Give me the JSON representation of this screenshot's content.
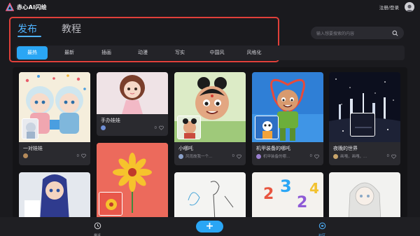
{
  "app": {
    "name": "赤心AI闪绘"
  },
  "topbar": {
    "login_label": "注册/登录"
  },
  "header": {
    "tabs": [
      {
        "label": "发布",
        "active": true
      },
      {
        "label": "教程",
        "active": false
      }
    ]
  },
  "search": {
    "placeholder": "输入想要搜索的内容"
  },
  "categories": [
    {
      "label": "最热",
      "active": true
    },
    {
      "label": "最新"
    },
    {
      "label": "插画"
    },
    {
      "label": "动漫"
    },
    {
      "label": "写实"
    },
    {
      "label": "中国风"
    },
    {
      "label": "风格化"
    }
  ],
  "cards": [
    {
      "title": "一对娃娃",
      "user": "",
      "count": "0"
    },
    {
      "title": "手办娃娃",
      "user": "",
      "count": "0"
    },
    {
      "title": "小哪吒",
      "user": "风雨故我一个...",
      "count": "0"
    },
    {
      "title": "机甲装备的哪吒",
      "user": "机甲装备的哪...",
      "count": "0"
    },
    {
      "title": "夜晚的世界",
      "user": "画嘎，画嘎，...",
      "count": "0"
    }
  ],
  "bottom_nav": {
    "recent_label": "最近",
    "add_label": "+",
    "community_label": "社区"
  },
  "colors": {
    "accent": "#2aa6f5",
    "highlight_border": "#e0403a",
    "background": "#1a1a1e"
  }
}
